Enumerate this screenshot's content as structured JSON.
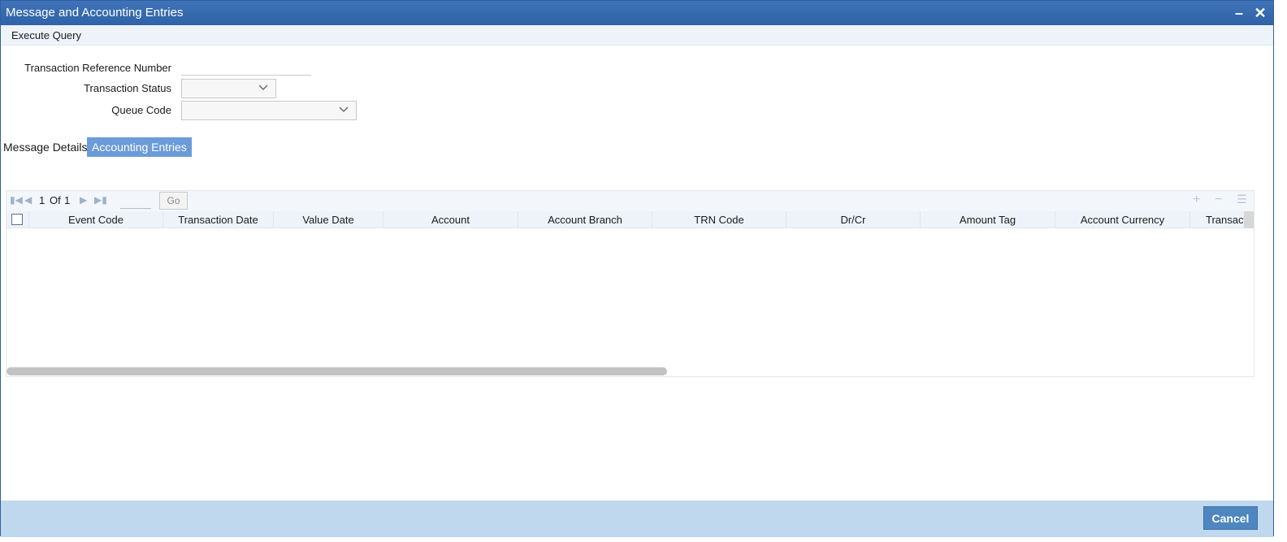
{
  "window": {
    "title": "Message and Accounting Entries"
  },
  "menu": {
    "execute_query": "Execute Query"
  },
  "form": {
    "txn_ref_label": "Transaction Reference Number",
    "txn_ref_value": "",
    "txn_status_label": "Transaction Status",
    "txn_status_value": "",
    "queue_code_label": "Queue Code",
    "queue_code_value": ""
  },
  "tabs": [
    {
      "label": "Message Details",
      "active": false
    },
    {
      "label": "Accounting Entries",
      "active": true
    }
  ],
  "grid": {
    "pager": {
      "current": "1",
      "of_label": "Of",
      "total": "1",
      "go_label": "Go"
    },
    "columns": [
      "Event Code",
      "Transaction Date",
      "Value Date",
      "Account",
      "Account Branch",
      "TRN Code",
      "Dr/Cr",
      "Amount Tag",
      "Account Currency",
      "Transact"
    ],
    "rows": []
  },
  "footer": {
    "cancel_label": "Cancel"
  },
  "colors": {
    "titlebar": "#2f62a6",
    "active_tab": "#6b9bd8",
    "footer": "#bfd8ee",
    "button": "#4e86bf"
  }
}
